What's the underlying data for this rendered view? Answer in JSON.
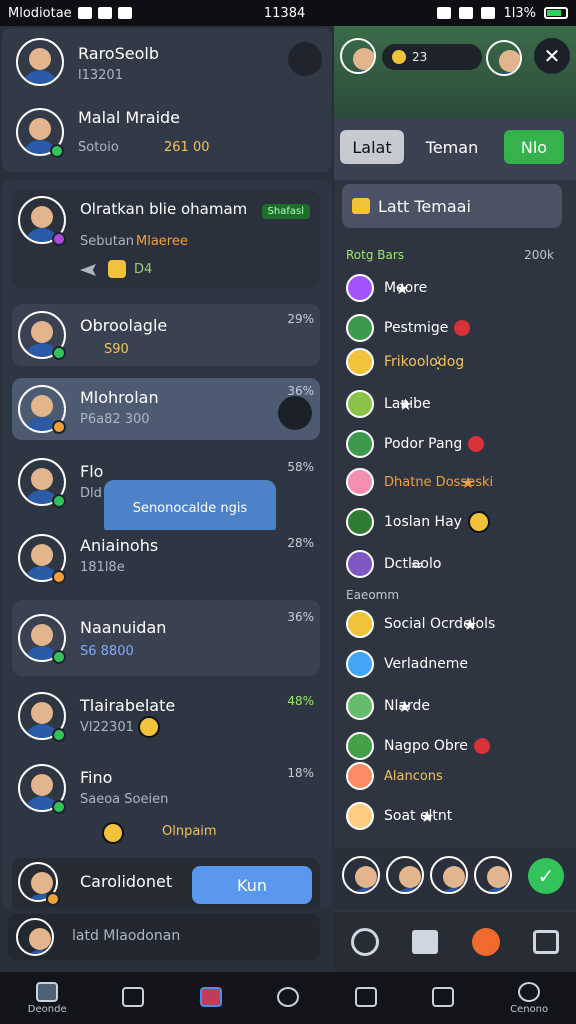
{
  "status": {
    "left": "Mlodiotae",
    "center": "11384",
    "right": "1l3%"
  },
  "left": {
    "top_cards": [
      {
        "name": "RaroSeolb",
        "sub": "l13201"
      },
      {
        "name": "Malal Mraide",
        "sub": "Sotoio",
        "value": "261 00"
      }
    ],
    "chat_cards": [
      {
        "name": "Olratkan blie ohamam",
        "sub": "Sebutan",
        "sub2": "Mlaeree",
        "tag": "Shafasl",
        "bottom": "D4"
      },
      {
        "name": "Obroolagle",
        "pct": "29%",
        "sub": "S90"
      },
      {
        "name": "Mlohrolan",
        "pct": "36%",
        "sub": "P6a82 300"
      },
      {
        "name": "Flo",
        "pct": "58%",
        "sub": "Dld"
      },
      {
        "name": "Aniainohs",
        "pct": "28%",
        "sub": "181l8e"
      },
      {
        "name": "Naanuidan",
        "pct": "36%",
        "sub": "S6 8800"
      },
      {
        "name": "Tlairabelate",
        "pct": "48%",
        "sub": "Vl22301"
      },
      {
        "name": "Fino",
        "pct": "18%",
        "sub": "Saeoa Soeien",
        "bottom": "Olnpaim"
      }
    ],
    "popup": {
      "text": "Senonocalde ngis"
    },
    "action_row": {
      "name": "Carolidonet",
      "button": "Kun"
    },
    "composer": {
      "placeholder": "latd Mlaodonan"
    }
  },
  "right": {
    "top_number": "23",
    "tabs": [
      {
        "label": "Lalat"
      },
      {
        "label": "Teman"
      },
      {
        "label": "Nlo"
      }
    ],
    "header": {
      "title": "Latt Temaai"
    },
    "group1": {
      "title": "Rotg Bars",
      "count": "200k"
    },
    "items1": [
      {
        "label": "Moore"
      },
      {
        "label": "Pestmige"
      },
      {
        "label": "Frikoolodog"
      },
      {
        "label": "Lanibe"
      },
      {
        "label": "Podor Pang"
      },
      {
        "label": "Dhatne Dosseski"
      },
      {
        "label": "1oslan Hay"
      },
      {
        "label": "Dctlaolo"
      }
    ],
    "group2": {
      "title": "Eaeomm"
    },
    "items2": [
      {
        "label": "Social Ocrdolols"
      },
      {
        "label": "Verladneme"
      },
      {
        "label": "Nlarde"
      },
      {
        "label": "Nagpo Obre"
      },
      {
        "label": "Alancons"
      },
      {
        "label": "Soat oltnt"
      }
    ]
  },
  "nav": {
    "left_label": "Deonde",
    "right_label": "Cenono"
  }
}
